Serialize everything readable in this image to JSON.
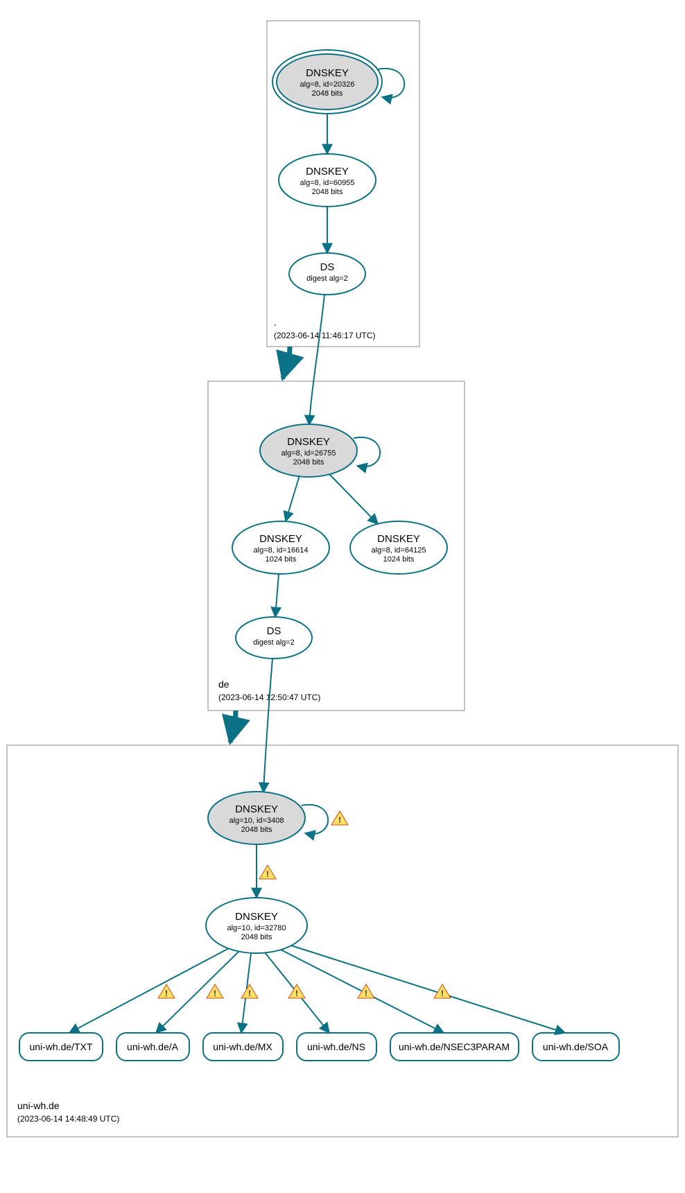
{
  "zones": {
    "root": {
      "name": ".",
      "date": "(2023-06-14 11:46:17 UTC)"
    },
    "de": {
      "name": "de",
      "date": "(2023-06-14 12:50:47 UTC)"
    },
    "leaf": {
      "name": "uni-wh.de",
      "date": "(2023-06-14 14:48:49 UTC)"
    }
  },
  "nodes": {
    "root_ksk": {
      "title": "DNSKEY",
      "sub1": "alg=8, id=20326",
      "sub2": "2048 bits"
    },
    "root_zsk": {
      "title": "DNSKEY",
      "sub1": "alg=8, id=60955",
      "sub2": "2048 bits"
    },
    "root_ds": {
      "title": "DS",
      "sub1": "digest alg=2"
    },
    "de_ksk": {
      "title": "DNSKEY",
      "sub1": "alg=8, id=26755",
      "sub2": "2048 bits"
    },
    "de_zsk1": {
      "title": "DNSKEY",
      "sub1": "alg=8, id=16614",
      "sub2": "1024 bits"
    },
    "de_zsk2": {
      "title": "DNSKEY",
      "sub1": "alg=8, id=64125",
      "sub2": "1024 bits"
    },
    "de_ds": {
      "title": "DS",
      "sub1": "digest alg=2"
    },
    "leaf_ksk": {
      "title": "DNSKEY",
      "sub1": "alg=10, id=3408",
      "sub2": "2048 bits"
    },
    "leaf_zsk": {
      "title": "DNSKEY",
      "sub1": "alg=10, id=32780",
      "sub2": "2048 bits"
    }
  },
  "rr": {
    "txt": "uni-wh.de/TXT",
    "a": "uni-wh.de/A",
    "mx": "uni-wh.de/MX",
    "ns": "uni-wh.de/NS",
    "nsec": "uni-wh.de/NSEC3PARAM",
    "soa": "uni-wh.de/SOA"
  },
  "colors": {
    "stroke": "#0b7285",
    "warnFill": "#ffe066",
    "warnStroke": "#d9480f"
  }
}
